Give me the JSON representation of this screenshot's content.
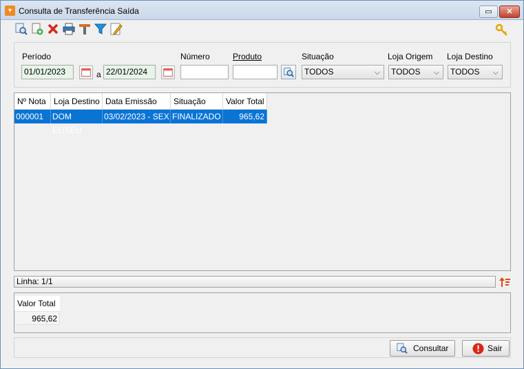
{
  "window": {
    "title": "Consulta de Transferência Saída",
    "restore_symbol": "▭",
    "close_symbol": "✕"
  },
  "toolbar": {
    "icons": [
      "search-doc-icon",
      "new-doc-icon",
      "delete-icon",
      "print-icon",
      "tools-icon",
      "filter-icon",
      "edit-icon"
    ],
    "key_icon": "key-icon"
  },
  "filters": {
    "periodo_label": "Período",
    "date_from": "01/01/2023",
    "separator": "a",
    "date_to": "22/01/2024",
    "numero_label": "Número",
    "numero_value": "",
    "produto_label": "Produto",
    "produto_value": "",
    "situacao_label": "Situação",
    "situacao_value": "TODOS",
    "loja_origem_label": "Loja Origem",
    "loja_origem_value": "TODOS",
    "loja_destino_label": "Loja Destino",
    "loja_destino_value": "TODOS",
    "chevron": "⌵"
  },
  "grid": {
    "columns": [
      "Nº Nota",
      "Loja Destino",
      "Data Emissão",
      "Situação",
      "Valor Total"
    ],
    "rows": [
      [
        "000001",
        "DOM ELISEU",
        "03/02/2023 - SEX",
        "FINALIZADO",
        "965,62"
      ]
    ]
  },
  "status": {
    "linha": "Linha: 1/1"
  },
  "totals": {
    "label": "Valor Total",
    "value": "965,62"
  },
  "buttons": {
    "consultar": "Consultar",
    "sair": "Sair"
  },
  "colors": {
    "selection": "#0a74d5",
    "accent_orange": "#f08a24"
  }
}
